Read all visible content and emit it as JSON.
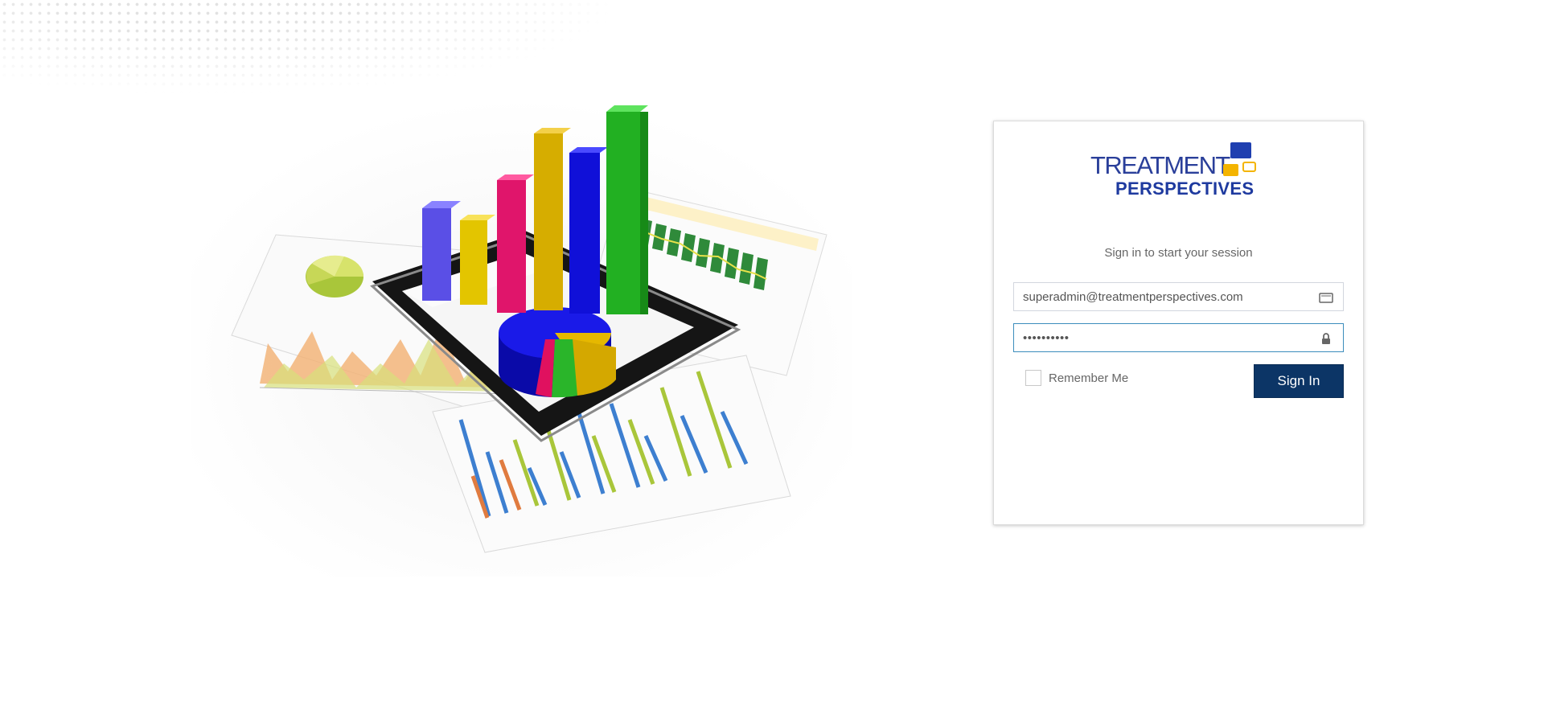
{
  "logo": {
    "line1": "TREATMENT",
    "line2": "PERSPECTIVES"
  },
  "login": {
    "subtitle": "Sign in to start your session",
    "email_value": "superadmin@treatmentperspectives.com",
    "password_value": "••••••••••",
    "remember_label": "Remember Me",
    "signin_label": "Sign In",
    "remember_checked": false
  },
  "icons": {
    "email": "envelope-icon",
    "password": "lock-icon"
  },
  "colors": {
    "button": "#0c3566",
    "logo_blue": "#1f3fb0",
    "logo_gold": "#f4b400",
    "focus_border": "#3c8dbc"
  }
}
